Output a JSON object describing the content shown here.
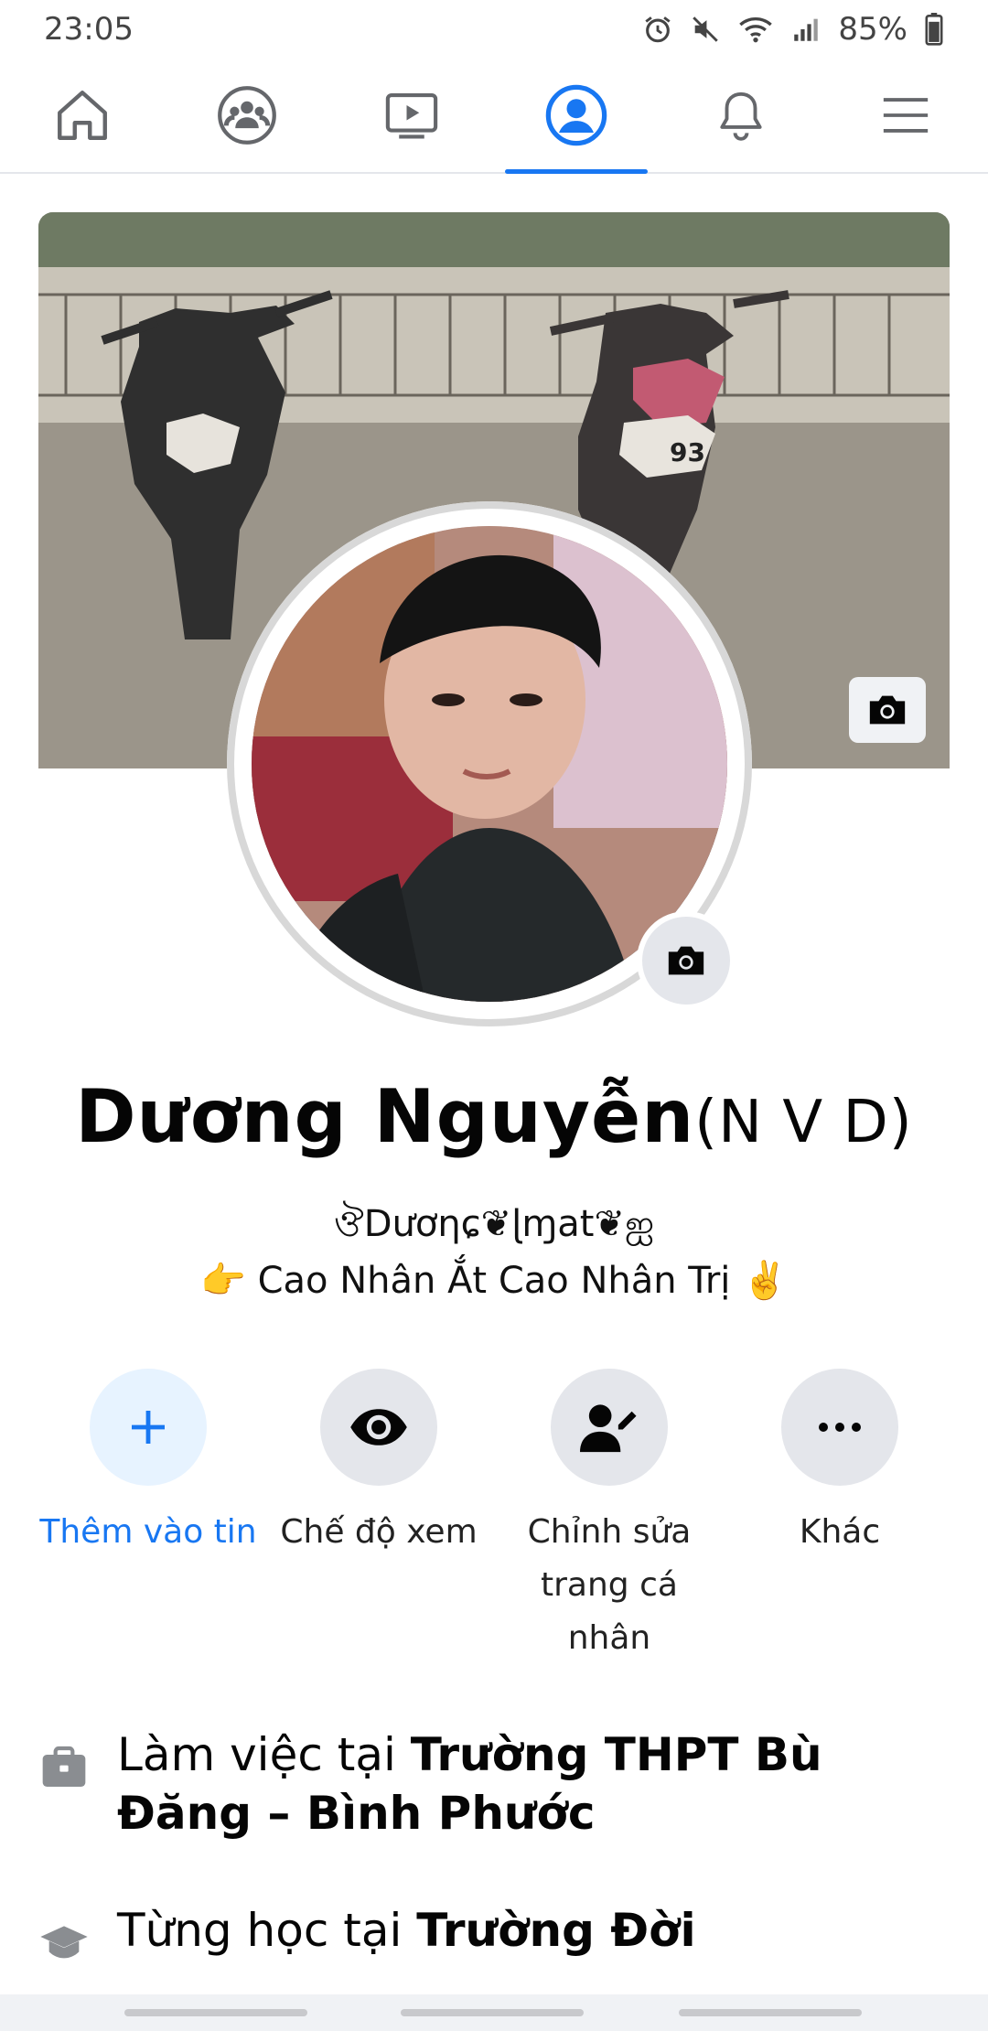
{
  "status_bar": {
    "time": "23:05",
    "battery": "85%"
  },
  "nav": {
    "tabs": [
      {
        "icon": "home-icon"
      },
      {
        "icon": "groups-icon"
      },
      {
        "icon": "watch-icon"
      },
      {
        "icon": "profile-icon",
        "active": true
      },
      {
        "icon": "bell-icon"
      },
      {
        "icon": "menu-icon"
      }
    ]
  },
  "profile": {
    "name": "Dương Nguyễn",
    "nickname": "(N V D)",
    "bio_line1": "ঔDươηɕ❦ɭɱat❦ஐ",
    "bio_line2": "👉 Cao Nhân Ắt Cao Nhân Trị ✌️"
  },
  "actions": [
    {
      "label": "Thêm vào tin",
      "icon": "plus-icon"
    },
    {
      "label": "Chế độ xem",
      "icon": "eye-icon"
    },
    {
      "label": "Chỉnh sửa trang cá nhân",
      "icon": "edit-profile-icon"
    },
    {
      "label": "Khác",
      "icon": "more-icon"
    }
  ],
  "info": {
    "work_prefix": "Làm việc tại ",
    "work_place": "Trường THPT Bù Đăng – Bình Phước",
    "study_prefix": "Từng học tại ",
    "study_place": "Trường Đời"
  },
  "colors": {
    "accent": "#1877f2",
    "circle_bg": "#e4e6eb"
  }
}
